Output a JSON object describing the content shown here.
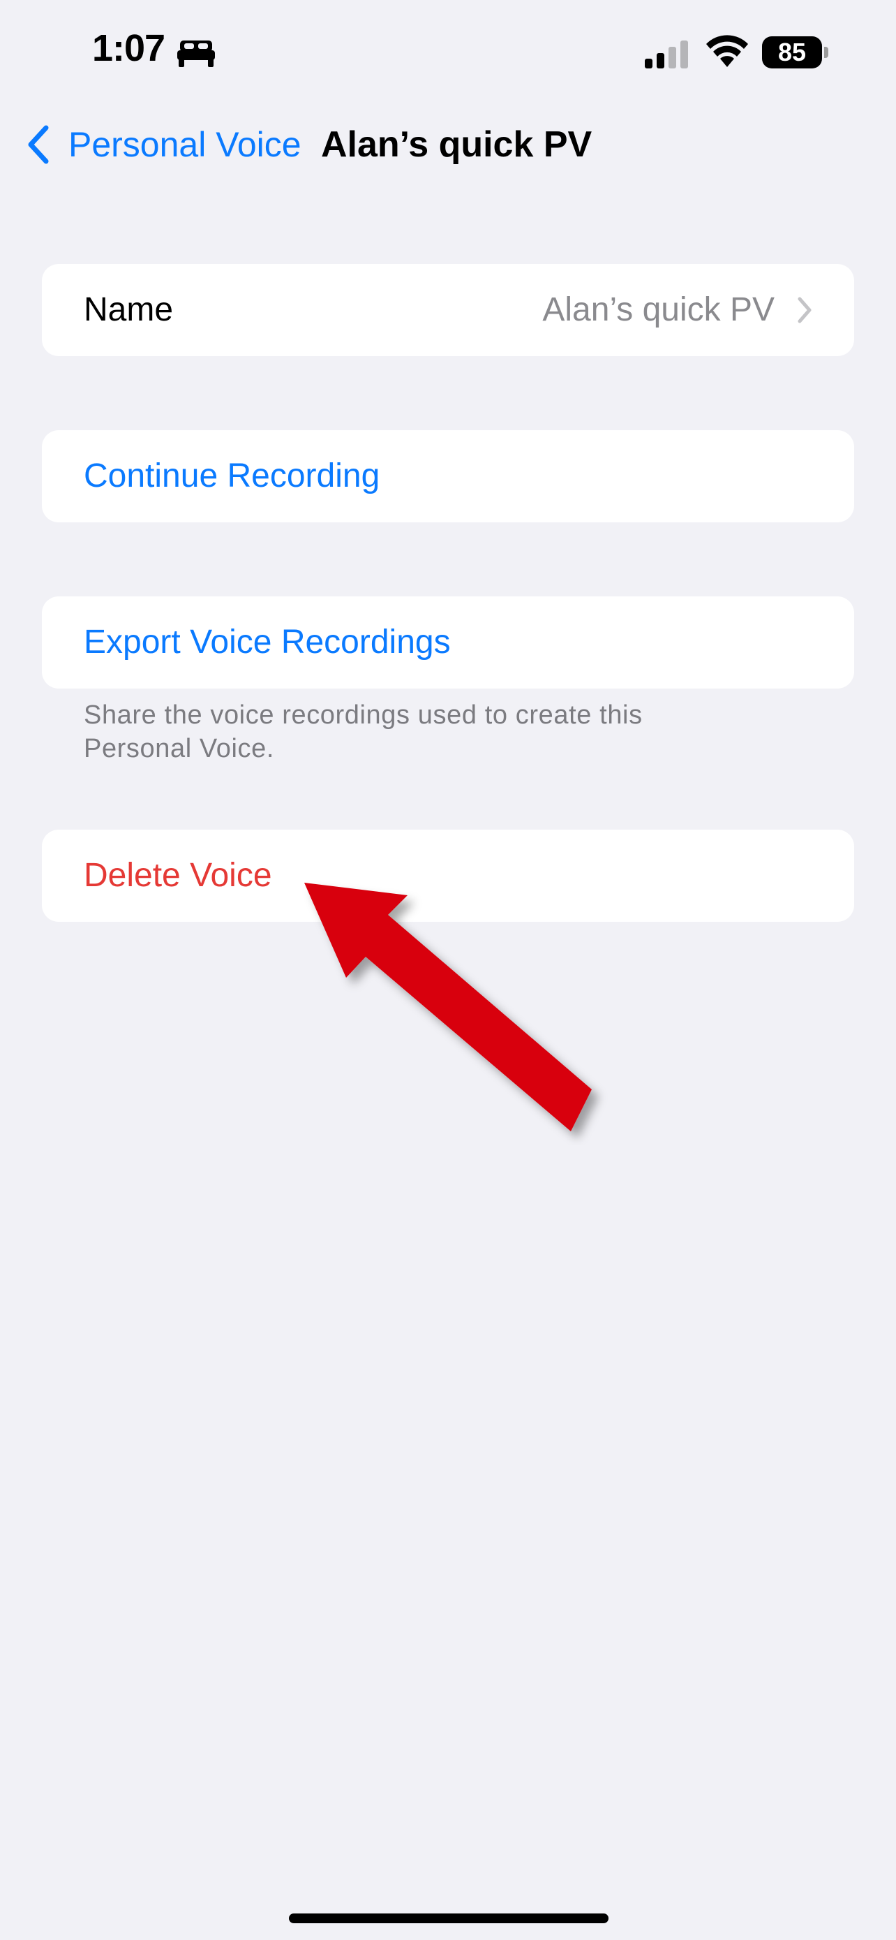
{
  "status_bar": {
    "time": "1:07",
    "focus_icon": "sleep-bed-icon",
    "battery_level": "85"
  },
  "nav": {
    "back_label": "Personal Voice",
    "title": "Alan’s quick PV"
  },
  "name_row": {
    "label": "Name",
    "value": "Alan’s quick PV"
  },
  "actions": {
    "continue_recording": "Continue Recording",
    "export_recordings": "Export Voice Recordings",
    "export_footer": "Share the voice recordings used to create this Personal Voice.",
    "delete_voice": "Delete Voice"
  },
  "colors": {
    "background": "#f1f1f6",
    "accent_blue": "#0a7aff",
    "destructive_red": "#e53935",
    "annotation_arrow": "#d8000c"
  }
}
